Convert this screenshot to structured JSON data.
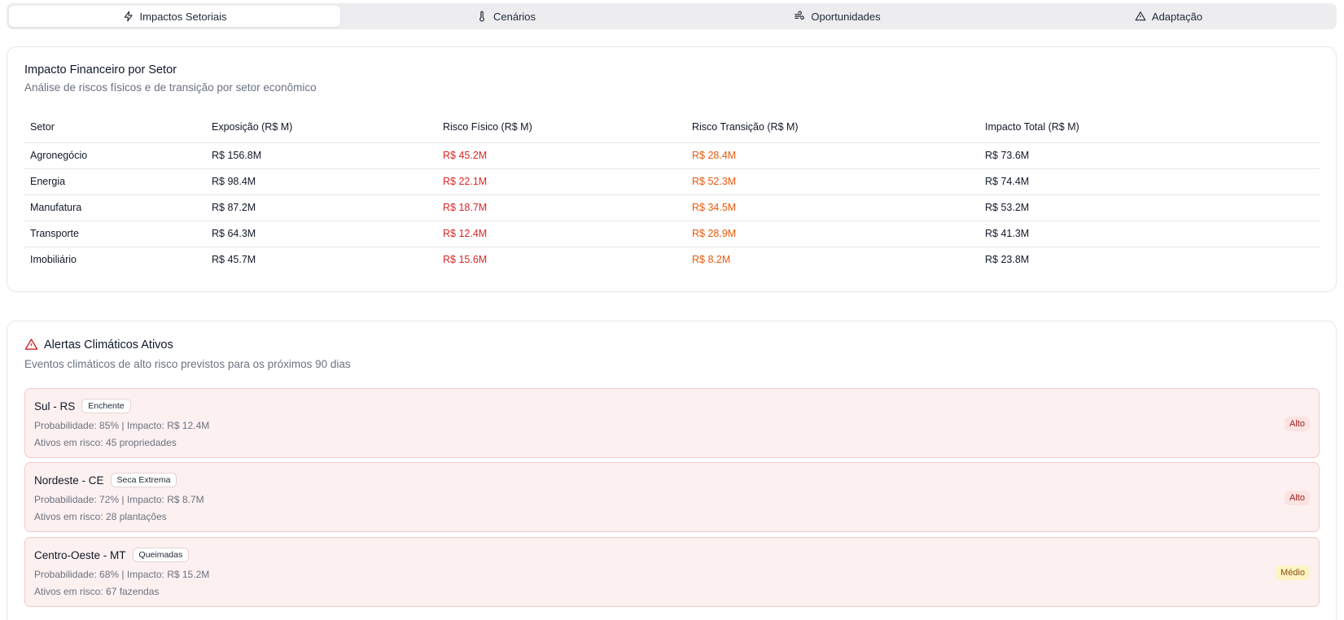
{
  "tabs": [
    {
      "label": "Impactos Setoriais",
      "icon": "lightning-icon",
      "active": true
    },
    {
      "label": "Cenários",
      "icon": "thermometer-icon",
      "active": false
    },
    {
      "label": "Oportunidades",
      "icon": "wind-icon",
      "active": false
    },
    {
      "label": "Adaptação",
      "icon": "warning-triangle-icon",
      "active": false
    }
  ],
  "financial": {
    "title": "Impacto Financeiro por Setor",
    "subtitle": "Análise de riscos físicos e de transição por setor econômico",
    "columns": [
      "Setor",
      "Exposição (R$ M)",
      "Risco Físico (R$ M)",
      "Risco Transição (R$ M)",
      "Impacto Total (R$ M)"
    ],
    "rows": [
      {
        "sector": "Agronegócio",
        "exposure": "R$ 156.8M",
        "physical": "R$ 45.2M",
        "transition": "R$ 28.4M",
        "total": "R$ 73.6M"
      },
      {
        "sector": "Energia",
        "exposure": "R$ 98.4M",
        "physical": "R$ 22.1M",
        "transition": "R$ 52.3M",
        "total": "R$ 74.4M"
      },
      {
        "sector": "Manufatura",
        "exposure": "R$ 87.2M",
        "physical": "R$ 18.7M",
        "transition": "R$ 34.5M",
        "total": "R$ 53.2M"
      },
      {
        "sector": "Transporte",
        "exposure": "R$ 64.3M",
        "physical": "R$ 12.4M",
        "transition": "R$ 28.9M",
        "total": "R$ 41.3M"
      },
      {
        "sector": "Imobiliário",
        "exposure": "R$ 45.7M",
        "physical": "R$ 15.6M",
        "transition": "R$ 8.2M",
        "total": "R$ 23.8M"
      }
    ],
    "colors": {
      "physical": "#dc2626",
      "transition": "#ea580c"
    }
  },
  "alerts": {
    "title": "Alertas Climáticos Ativos",
    "subtitle": "Eventos climáticos de alto risco previstos para os próximos 90 dias",
    "items": [
      {
        "region": "Sul - RS",
        "event": "Enchente",
        "line1": "Probabilidade: 85% | Impacto: R$ 12.4M",
        "line2": "Ativos em risco: 45 propriedades",
        "level": "Alto",
        "severity": "high"
      },
      {
        "region": "Nordeste - CE",
        "event": "Seca Extrema",
        "line1": "Probabilidade: 72% | Impacto: R$ 8.7M",
        "line2": "Ativos em risco: 28 plantações",
        "level": "Alto",
        "severity": "high"
      },
      {
        "region": "Centro-Oeste - MT",
        "event": "Queimadas",
        "line1": "Probabilidade: 68% | Impacto: R$ 15.2M",
        "line2": "Ativos em risco: 67 fazendas",
        "level": "Médio",
        "severity": "medium"
      }
    ]
  }
}
